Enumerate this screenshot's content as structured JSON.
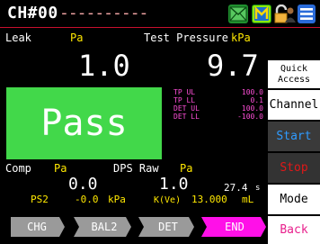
{
  "header": {
    "title": "CH#00",
    "dashes": "----------",
    "icons": [
      "envelope-icon",
      "m-icon",
      "lock-user-icon",
      "menu-icon"
    ],
    "colors": {
      "envelope": "#39b54a",
      "m": "#7fe000",
      "lock": "#f2b33d",
      "menu": "#1e5bd7"
    }
  },
  "leak": {
    "label": "Leak",
    "unit": "Pa",
    "value": "1.0"
  },
  "test_pressure": {
    "label": "Test Pressure",
    "unit": "kPa",
    "value": "9.7"
  },
  "result": {
    "text": "Pass",
    "color": "#42d84a"
  },
  "limits": [
    {
      "name": "TP UL",
      "value": "100.0"
    },
    {
      "name": "TP LL",
      "value": "0.1"
    },
    {
      "name": "DET UL",
      "value": "100.0"
    },
    {
      "name": "DET LL",
      "value": "-100.0"
    }
  ],
  "comp": {
    "label": "Comp",
    "unit": "Pa",
    "value": "0.0"
  },
  "dps_raw": {
    "label": "DPS Raw",
    "unit": "Pa",
    "value": "1.0"
  },
  "ps2": {
    "label": "PS2",
    "value": "-0.0",
    "unit": "kPa"
  },
  "time": {
    "value": "27.4",
    "unit": "s"
  },
  "kve": {
    "label": "K(Ve)",
    "value": "13.000",
    "unit": "mL"
  },
  "sidebar": {
    "quick_access_1": "Quick",
    "quick_access_2": "Access",
    "channel": "Channel",
    "start": "Start",
    "stop": "Stop",
    "mode": "Mode",
    "back": "Back"
  },
  "steps": [
    "CHG",
    "BAL2",
    "DET",
    "END"
  ]
}
